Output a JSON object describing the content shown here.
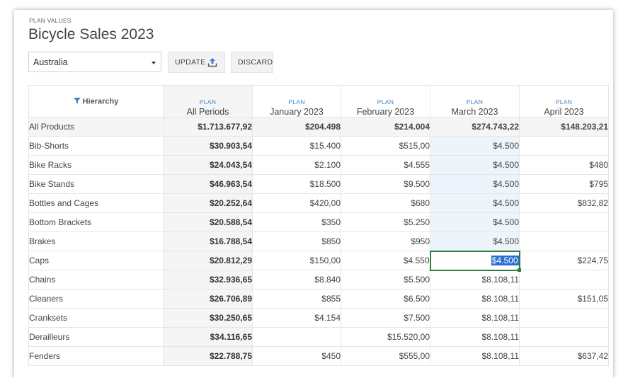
{
  "header": {
    "eyebrow": "PLAN VALUES",
    "title": "Bicycle Sales 2023"
  },
  "controls": {
    "region_selected": "Australia",
    "update_label": "UPDATE",
    "discard_label": "DISCARD"
  },
  "grid": {
    "hierarchy_label": "Hierarchy",
    "plan_label": "PLAN",
    "columns": [
      "All Periods",
      "January 2023",
      "February 2023",
      "March 2023",
      "April 2023"
    ],
    "rows": [
      {
        "label": "All Products",
        "cells": [
          "$1.713.677,92",
          "$204.498",
          "$214.004",
          "$274.743,22",
          "$148.203,21"
        ]
      },
      {
        "label": "Bib-Shorts",
        "cells": [
          "$30.903,54",
          "$15.400",
          "$515,00",
          "$4.500",
          ""
        ]
      },
      {
        "label": "Bike Racks",
        "cells": [
          "$24.043,54",
          "$2.100",
          "$4.555",
          "$4.500",
          "$480"
        ]
      },
      {
        "label": "Bike Stands",
        "cells": [
          "$46.963,54",
          "$18.500",
          "$9.500",
          "$4.500",
          "$795"
        ]
      },
      {
        "label": "Bottles and Cages",
        "cells": [
          "$20.252,64",
          "$420,00",
          "$680",
          "$4.500",
          "$832,82"
        ]
      },
      {
        "label": "Bottom Brackets",
        "cells": [
          "$20.588,54",
          "$350",
          "$5.250",
          "$4.500",
          ""
        ]
      },
      {
        "label": "Brakes",
        "cells": [
          "$16.788,54",
          "$850",
          "$950",
          "$4.500",
          ""
        ]
      },
      {
        "label": "Caps",
        "cells": [
          "$20.812,29",
          "$150,00",
          "$4.550",
          "$4.500",
          "$224,75"
        ]
      },
      {
        "label": "Chains",
        "cells": [
          "$32.936,65",
          "$8.840",
          "$5.500",
          "$8.108,11",
          ""
        ]
      },
      {
        "label": "Cleaners",
        "cells": [
          "$26.706,89",
          "$855",
          "$6.500",
          "$8.108,11",
          "$151,05"
        ]
      },
      {
        "label": "Cranksets",
        "cells": [
          "$30.250,65",
          "$4.154",
          "$7.500",
          "$8.108,11",
          ""
        ]
      },
      {
        "label": "Derailleurs",
        "cells": [
          "$34.116,65",
          "",
          "$15.520,00",
          "$8.108,11",
          ""
        ]
      },
      {
        "label": "Fenders",
        "cells": [
          "$22.788,75",
          "$450",
          "$555,00",
          "$8.108,11",
          "$637,42"
        ]
      }
    ]
  },
  "colors": {
    "accent": "#3a7fd5",
    "selection_border": "#2e7d3a",
    "highlight_column": "#eef4fc"
  }
}
